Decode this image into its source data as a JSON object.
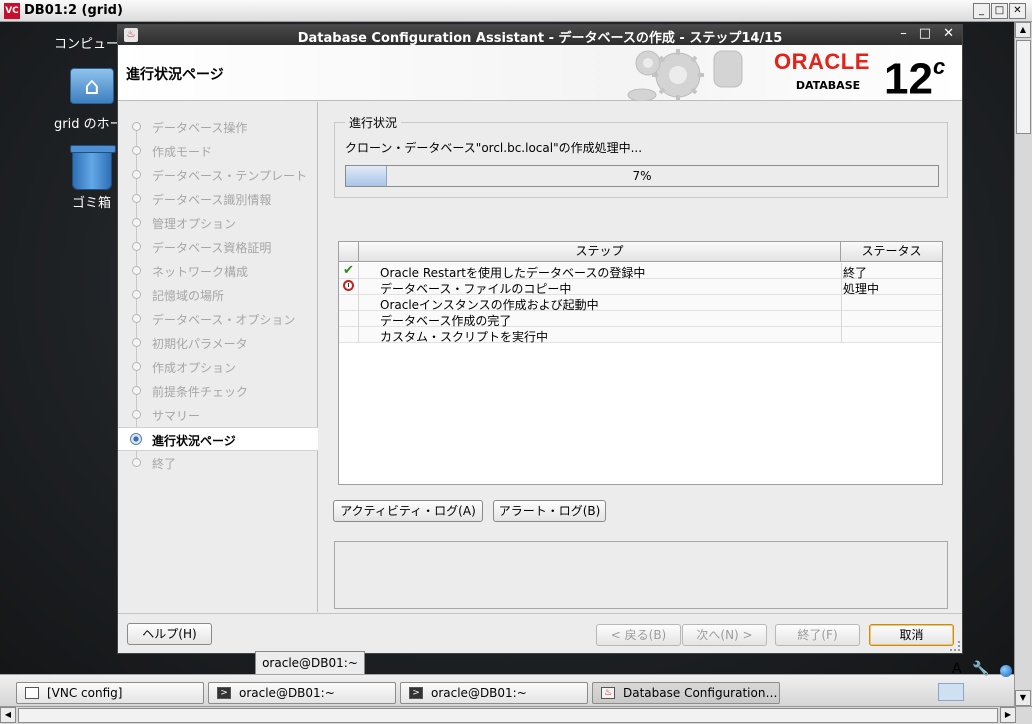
{
  "vnc": {
    "title": "DB01:2 (grid)",
    "logo": "VC",
    "controls": {
      "minimize": "_",
      "maximize": "□",
      "close": "✕"
    }
  },
  "desktop": {
    "icons": [
      {
        "label": "コンピュー",
        "icon": "computer-icon"
      },
      {
        "label": "grid のホー",
        "icon": "home-folder-icon"
      },
      {
        "label": "ゴミ箱",
        "icon": "trash-icon"
      }
    ]
  },
  "dialog": {
    "title": "Database Configuration Assistant - データベースの作成 - ステップ14/15",
    "controls": {
      "minimize": "–",
      "maximize": "□",
      "close": "✕"
    },
    "page_title": "進行状況ページ",
    "brand": {
      "oracle": "ORACLE",
      "database": "DATABASE",
      "version": "12",
      "version_suffix": "c"
    },
    "nav": [
      {
        "label": "データベース操作",
        "state": "done"
      },
      {
        "label": "作成モード",
        "state": "done"
      },
      {
        "label": "データベース・テンプレート",
        "state": "done"
      },
      {
        "label": "データベース識別情報",
        "state": "done"
      },
      {
        "label": "管理オプション",
        "state": "done"
      },
      {
        "label": "データベース資格証明",
        "state": "done"
      },
      {
        "label": "ネットワーク構成",
        "state": "done"
      },
      {
        "label": "記憶域の場所",
        "state": "done"
      },
      {
        "label": "データベース・オプション",
        "state": "done"
      },
      {
        "label": "初期化パラメータ",
        "state": "done"
      },
      {
        "label": "作成オプション",
        "state": "done"
      },
      {
        "label": "前提条件チェック",
        "state": "done"
      },
      {
        "label": "サマリー",
        "state": "done"
      },
      {
        "label": "進行状況ページ",
        "state": "active"
      },
      {
        "label": "終了",
        "state": "pending"
      }
    ],
    "progress": {
      "group_label": "進行状況",
      "status_text": "クローン・データベース\"orcl.bc.local\"の作成処理中...",
      "percent_label": "7%",
      "fraction": 0.07
    },
    "table": {
      "headers": {
        "step": "ステップ",
        "status": "ステータス"
      },
      "rows": [
        {
          "icon": "check-icon",
          "step": "Oracle Restartを使用したデータベースの登録中",
          "status": "終了"
        },
        {
          "icon": "clock-icon",
          "step": "データベース・ファイルのコピー中",
          "status": "処理中"
        },
        {
          "icon": "",
          "step": "Oracleインスタンスの作成および起動中",
          "status": ""
        },
        {
          "icon": "",
          "step": "データベース作成の完了",
          "status": ""
        },
        {
          "icon": "",
          "step": "カスタム・スクリプトを実行中",
          "status": ""
        }
      ]
    },
    "buttons": {
      "activity_log": "アクティビティ・ログ(A)",
      "alert_log": "アラート・ログ(B)",
      "help": "ヘルプ(H)",
      "back": "< 戻る(B)",
      "next": "次へ(N) >",
      "finish": "終了(F)",
      "cancel": "取消"
    }
  },
  "tooltip": "oracle@DB01:~",
  "taskbar": {
    "tasks": [
      {
        "label": "[VNC config]",
        "icon": "window-icon"
      },
      {
        "label": "oracle@DB01:~",
        "icon": "terminal-icon"
      },
      {
        "label": "oracle@DB01:~",
        "icon": "terminal-icon"
      },
      {
        "label": "Database Configuration…",
        "icon": "java-icon"
      }
    ],
    "tray": {
      "input_method": "A"
    }
  }
}
